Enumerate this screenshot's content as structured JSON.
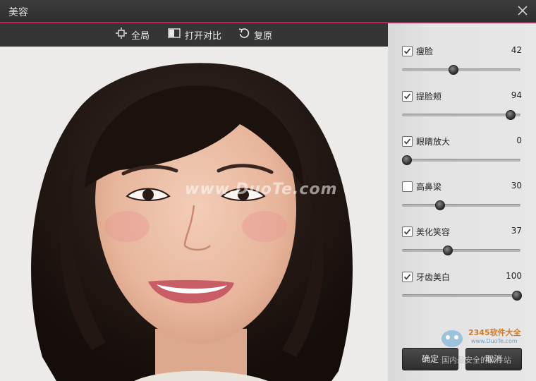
{
  "window": {
    "title": "美容"
  },
  "toolbar": {
    "fullview_label": "全局",
    "compare_label": "打开对比",
    "restore_label": "复原"
  },
  "watermarks": {
    "center": "www.DuoTe.com",
    "logo_main": "2345软件大全",
    "logo_url": "www.DuoTe.com",
    "bottom": "国内最安全的软件站"
  },
  "adjustments": [
    {
      "label": "瘦脸",
      "checked": true,
      "value": "42",
      "level": 42
    },
    {
      "label": "提脸颊",
      "checked": true,
      "value": "94",
      "level": 94
    },
    {
      "label": "眼睛放大",
      "checked": true,
      "value": "0",
      "level": 0
    },
    {
      "label": "高鼻梁",
      "checked": false,
      "value": "30",
      "level": 30
    },
    {
      "label": "美化笑容",
      "checked": true,
      "value": "37",
      "level": 37
    },
    {
      "label": "牙齿美白",
      "checked": true,
      "value": "100",
      "level": 100
    }
  ],
  "footer": {
    "ok_label": "确定",
    "cancel_label": "取消"
  },
  "colors": {
    "accent": "#b8245a",
    "title_bg": "#333333",
    "panel_bg": "#e4e4e4"
  }
}
